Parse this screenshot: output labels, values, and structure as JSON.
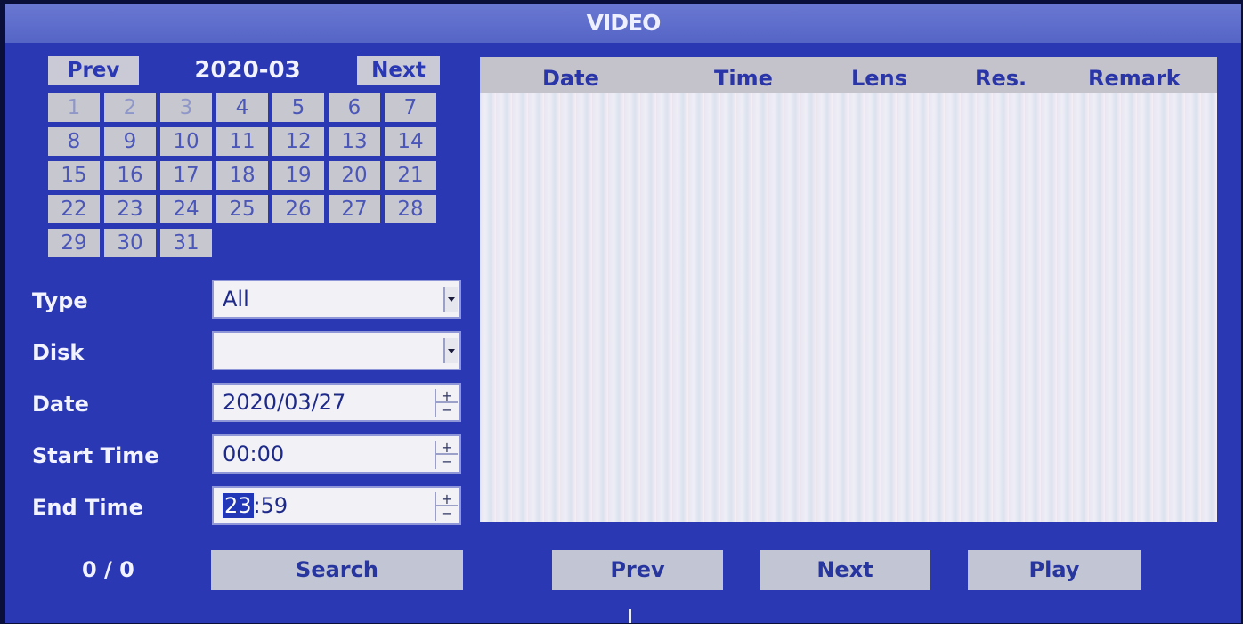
{
  "title": "VIDEO",
  "calendar": {
    "prev_label": "Prev",
    "next_label": "Next",
    "month": "2020-03",
    "days": [
      "1",
      "2",
      "3",
      "4",
      "5",
      "6",
      "7",
      "8",
      "9",
      "10",
      "11",
      "12",
      "13",
      "14",
      "15",
      "16",
      "17",
      "18",
      "19",
      "20",
      "21",
      "22",
      "23",
      "24",
      "25",
      "26",
      "27",
      "28",
      "29",
      "30",
      "31"
    ]
  },
  "form": {
    "type_label": "Type",
    "type_value": "All",
    "disk_label": "Disk",
    "disk_value": "",
    "date_label": "Date",
    "date_value": "2020/03/27",
    "start_label": "Start Time",
    "start_value": "00:00",
    "end_label": "End Time",
    "end_hour": "23",
    "end_sep": ":",
    "end_minute": "59",
    "spin_plus": "+",
    "spin_minus": "−"
  },
  "record_count": "0 / 0",
  "buttons": {
    "search": "Search",
    "prev": "Prev",
    "next": "Next",
    "play": "Play"
  },
  "table": {
    "columns": [
      "Date",
      "Time",
      "Lens",
      "Res.",
      "Remark"
    ],
    "rows": []
  }
}
